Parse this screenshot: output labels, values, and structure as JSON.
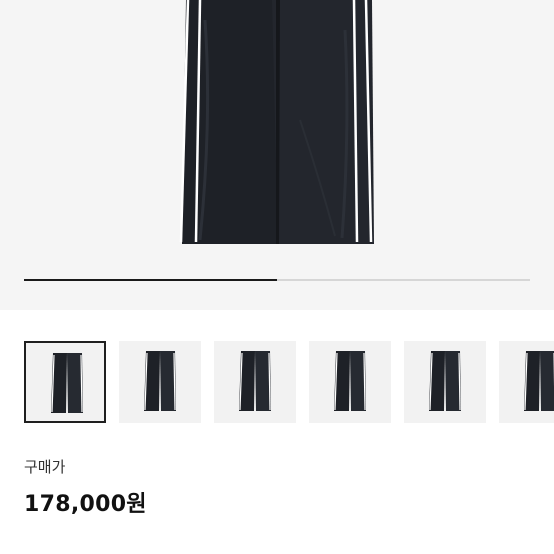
{
  "product": {
    "image_icon": "wide-track-pants-image",
    "gallery": {
      "progress_fraction": 0.5,
      "thumbnails": [
        {
          "icon": "pants-thumbnail",
          "selected": true
        },
        {
          "icon": "pants-thumbnail",
          "selected": false
        },
        {
          "icon": "pants-thumbnail",
          "selected": false
        },
        {
          "icon": "pants-thumbnail",
          "selected": false
        },
        {
          "icon": "pants-thumbnail",
          "selected": false
        },
        {
          "icon": "pants-thumbnail",
          "selected": false
        }
      ]
    },
    "price_label": "구매가",
    "price_value": "178,000원"
  },
  "colors": {
    "hero_background": "#f5f5f5",
    "garment": "#1e2127",
    "stripe": "#ffffff",
    "selected_border": "#1f1f1f"
  }
}
